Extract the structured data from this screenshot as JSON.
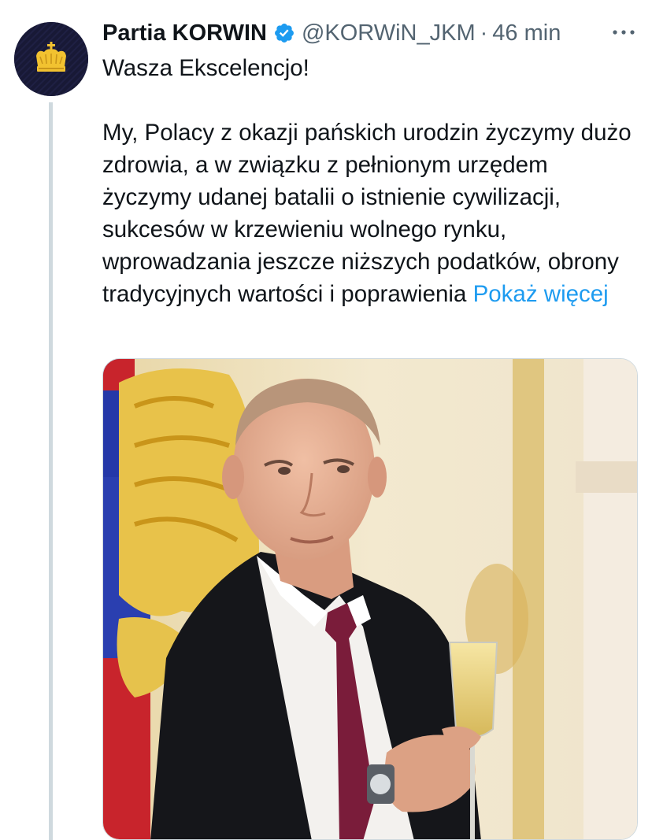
{
  "tweet": {
    "author": {
      "display_name": "Partia KORWIN",
      "verified_icon": "verified-badge-icon",
      "handle": "@KORWiN_JKM",
      "separator": "·",
      "time": "46 min"
    },
    "more_icon": "more-options-icon",
    "text": {
      "line1": "Wasza Ekscelencjo!",
      "line2": "My, Polacy z okazji pańskich urodzin życzymy dużo zdrowia, a w związku z pełnionym urzędem życzymy udanej batalii o istnienie cywilizacji, sukcesów w krzewieniu wolnego rynku, wprowadzania jeszcze niższych podatków, obrony tradycyjnych wartości i poprawienia",
      "show_more": "Pokaż więcej"
    },
    "colors": {
      "link": "#1d9bf0",
      "verified": "#1d9bf0",
      "secondary_text": "#536471"
    }
  }
}
